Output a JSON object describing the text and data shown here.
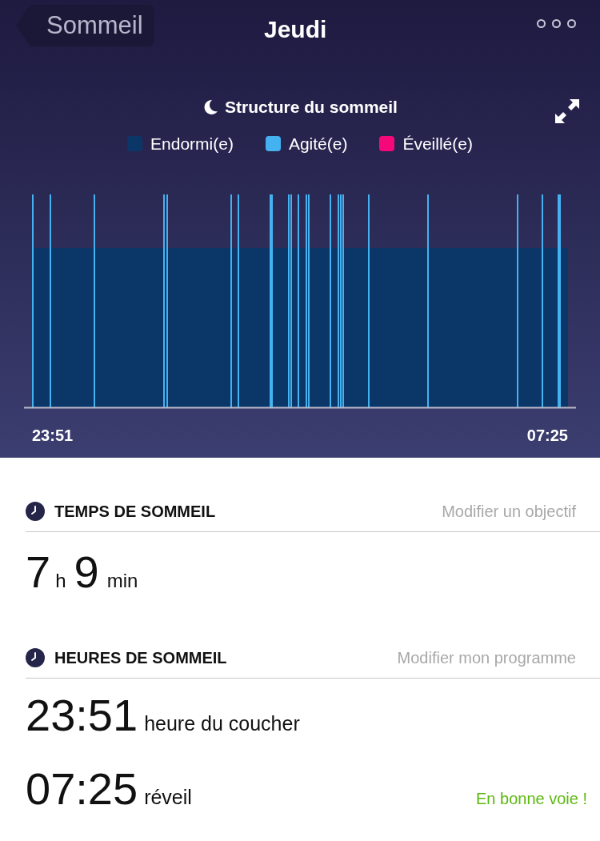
{
  "nav": {
    "back": "Sommeil",
    "title": "Jeudi"
  },
  "chart": {
    "title": "Structure du sommeil",
    "legend": [
      {
        "label": "Endormi(e)",
        "color": "#0a3668"
      },
      {
        "label": "Agité(e)",
        "color": "#44b1f0"
      },
      {
        "label": "Éveillé(e)",
        "color": "#f5097a"
      }
    ],
    "start": "23:51",
    "end": "07:25"
  },
  "sleep_time": {
    "heading": "TEMPS DE SOMMEIL",
    "link": "Modifier un objectif",
    "hours": "7",
    "hours_unit": "h",
    "minutes": "9",
    "minutes_unit": "min"
  },
  "sleep_hours": {
    "heading": "HEURES DE SOMMEIL",
    "link": "Modifier mon programme",
    "entries": [
      {
        "time": "23:51",
        "label": "heure du coucher"
      },
      {
        "time": "07:25",
        "label": "réveil"
      }
    ],
    "status": "En bonne voie !"
  }
}
